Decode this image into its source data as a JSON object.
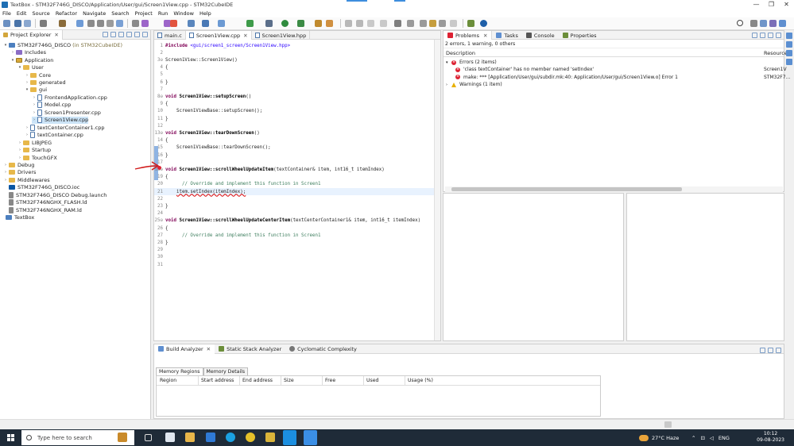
{
  "window": {
    "title": "TextBox - STM32F746G_DISCO/Application/User/gui/Screen1View.cpp - STM32CubeIDE",
    "min_label": "—",
    "max_label": "❐",
    "close_label": "✕"
  },
  "menu": [
    "File",
    "Edit",
    "Source",
    "Refactor",
    "Navigate",
    "Search",
    "Project",
    "Run",
    "Window",
    "Help"
  ],
  "project_explorer": {
    "tab_label": "Project Explorer",
    "items": [
      {
        "depth": 0,
        "arrow": "▾",
        "icon": "proj",
        "label": "STM32F746G_DISCO",
        "sub": "(in STM32CubeIDE)"
      },
      {
        "depth": 1,
        "arrow": "›",
        "icon": "inc",
        "label": "Includes"
      },
      {
        "depth": 1,
        "arrow": "▾",
        "icon": "src-folder",
        "label": "Application"
      },
      {
        "depth": 2,
        "arrow": "▾",
        "icon": "folder",
        "label": "User"
      },
      {
        "depth": 3,
        "arrow": "›",
        "icon": "folder",
        "label": "Core"
      },
      {
        "depth": 3,
        "arrow": "›",
        "icon": "folder",
        "label": "generated"
      },
      {
        "depth": 3,
        "arrow": "▾",
        "icon": "folder",
        "label": "gui"
      },
      {
        "depth": 4,
        "arrow": "›",
        "icon": "cfile",
        "label": "FrontendApplication.cpp"
      },
      {
        "depth": 4,
        "arrow": "›",
        "icon": "cfile",
        "label": "Model.cpp"
      },
      {
        "depth": 4,
        "arrow": "›",
        "icon": "cfile",
        "label": "Screen1Presenter.cpp"
      },
      {
        "depth": 4,
        "arrow": "›",
        "icon": "cfile",
        "label": "Screen1View.cpp",
        "selected": true
      },
      {
        "depth": 3,
        "arrow": "›",
        "icon": "cfile",
        "label": "textCenterContainer1.cpp"
      },
      {
        "depth": 3,
        "arrow": "›",
        "icon": "cfile",
        "label": "textContainer.cpp"
      },
      {
        "depth": 2,
        "arrow": "›",
        "icon": "folder",
        "label": "LIBJPEG"
      },
      {
        "depth": 2,
        "arrow": "›",
        "icon": "folder",
        "label": "Startup"
      },
      {
        "depth": 2,
        "arrow": "›",
        "icon": "folder",
        "label": "TouchGFX"
      },
      {
        "depth": 0,
        "arrow": "›",
        "icon": "folder",
        "label": "Debug"
      },
      {
        "depth": 0,
        "arrow": "›",
        "icon": "folder",
        "label": "Drivers"
      },
      {
        "depth": 0,
        "arrow": "›",
        "icon": "folder",
        "label": "Middlewares"
      },
      {
        "depth": 0,
        "arrow": "",
        "icon": "ioc",
        "label": "STM32F746G_DISCO.ioc"
      },
      {
        "depth": 0,
        "arrow": "",
        "icon": "ld",
        "label": "STM32F746G_DISCO Debug.launch"
      },
      {
        "depth": 0,
        "arrow": "",
        "icon": "ld",
        "label": "STM32F746NGHX_FLASH.ld"
      },
      {
        "depth": 0,
        "arrow": "",
        "icon": "ld",
        "label": "STM32F746NGHX_RAM.ld"
      },
      {
        "depth": -1,
        "arrow": "",
        "icon": "proj",
        "label": "TextBox"
      }
    ]
  },
  "editor": {
    "tabs": [
      {
        "label": "main.c",
        "active": false
      },
      {
        "label": "Screen1View.cpp",
        "active": true
      },
      {
        "label": "Screen1View.hpp",
        "active": false
      }
    ],
    "lines": [
      {
        "n": "1",
        "html": "<span class='kw'>#include</span> <span class='str'>&lt;gui/screen1_screen/Screen1View.hpp&gt;</span>"
      },
      {
        "n": "2",
        "html": ""
      },
      {
        "n": "3",
        "fold": true,
        "html": "Screen1View::Screen1View()"
      },
      {
        "n": "4",
        "html": "{"
      },
      {
        "n": "5",
        "html": ""
      },
      {
        "n": "6",
        "html": "}"
      },
      {
        "n": "7",
        "html": ""
      },
      {
        "n": "8",
        "fold": true,
        "html": "<span class='kw'>void</span> <span class='fn'>Screen1View::setupScreen</span>()"
      },
      {
        "n": "9",
        "html": "{"
      },
      {
        "n": "10",
        "html": "    Screen1ViewBase::setupScreen();"
      },
      {
        "n": "11",
        "html": "}"
      },
      {
        "n": "12",
        "html": ""
      },
      {
        "n": "13",
        "fold": true,
        "html": "<span class='kw'>void</span> <span class='fn'>Screen1View::tearDownScreen</span>()"
      },
      {
        "n": "14",
        "html": "{"
      },
      {
        "n": "15",
        "html": "    Screen1ViewBase::tearDownScreen();"
      },
      {
        "n": "16",
        "html": "}"
      },
      {
        "n": "17",
        "html": ""
      },
      {
        "n": "18",
        "fold": true,
        "html": "<span class='kw'>void</span> <span class='fn'>Screen1View::scrollWheelUpdateItem</span>(textContainer&amp; item, int16_t itemIndex)"
      },
      {
        "n": "19",
        "html": "{"
      },
      {
        "n": "20",
        "html": "      <span class='cmt'>// Override and implement this function in Screen1</span>"
      },
      {
        "n": "21",
        "cur": true,
        "html": "    <span class='err-underline'>item.setIndex(itemIndex);</span>"
      },
      {
        "n": "22",
        "html": ""
      },
      {
        "n": "23",
        "html": "}"
      },
      {
        "n": "24",
        "html": ""
      },
      {
        "n": "25",
        "fold": true,
        "html": "<span class='kw'>void</span> <span class='fn'>Screen1View::scrollWheelUpdateCenterItem</span>(textCenterContainer1&amp; item, int16_t itemIndex)"
      },
      {
        "n": "26",
        "html": "{"
      },
      {
        "n": "27",
        "html": "      <span class='cmt'>// Override and implement this function in Screen1</span>"
      },
      {
        "n": "28",
        "html": "}"
      },
      {
        "n": "29",
        "html": ""
      },
      {
        "n": "30",
        "html": ""
      },
      {
        "n": "31",
        "html": ""
      }
    ]
  },
  "problems": {
    "tabs": [
      "Problems",
      "Tasks",
      "Console",
      "Properties"
    ],
    "summary": "2 errors, 1 warning, 0 others",
    "col_description": "Description",
    "col_resource": "Resource",
    "rows": [
      {
        "indent": 0,
        "type": "group-error",
        "arrow": "▾",
        "text": "Errors (2 items)",
        "resource": ""
      },
      {
        "indent": 1,
        "type": "error",
        "text": "'class textContainer' has no member named 'setIndex'",
        "resource": "Screen1V"
      },
      {
        "indent": 1,
        "type": "error",
        "text": "make: *** [Application/User/gui/subdir.mk:40: Application/User/gui/Screen1View.o] Error 1",
        "resource": "STM32F7..."
      },
      {
        "indent": 0,
        "type": "group-warn",
        "arrow": "›",
        "text": "Warnings (1 item)",
        "resource": ""
      }
    ]
  },
  "bottom": {
    "tabs": [
      "Build Analyzer",
      "Static Stack Analyzer",
      "Cyclomatic Complexity"
    ],
    "subtabs": [
      "Memory Regions",
      "Memory Details"
    ],
    "columns": [
      "Region",
      "Start address",
      "End address",
      "Size",
      "Free",
      "Used",
      "Usage (%)"
    ]
  },
  "taskbar": {
    "search_placeholder": "Type here to search",
    "weather": "27°C  Haze",
    "lang": "ENG",
    "time": "10:12",
    "date": "09-08-2023"
  }
}
